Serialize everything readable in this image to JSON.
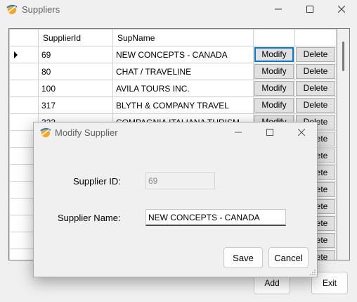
{
  "window": {
    "title": "Suppliers",
    "controls": [
      "minimize",
      "maximize",
      "close"
    ]
  },
  "grid": {
    "columns": [
      "SupplierId",
      "SupName"
    ],
    "button_labels": {
      "modify": "Modify",
      "delete": "Delete"
    },
    "selected_row": 0,
    "rows": [
      {
        "id": "69",
        "name": "NEW CONCEPTS - CANADA"
      },
      {
        "id": "80",
        "name": "CHAT / TRAVELINE"
      },
      {
        "id": "100",
        "name": "AVILA TOURS INC."
      },
      {
        "id": "317",
        "name": "BLYTH & COMPANY TRAVEL"
      },
      {
        "id": "323",
        "name": "COMPAGNIA ITALIANA TURISM"
      },
      {
        "id": "",
        "name": ""
      },
      {
        "id": "",
        "name": ""
      },
      {
        "id": "",
        "name": ""
      },
      {
        "id": "",
        "name": ""
      },
      {
        "id": "",
        "name": ""
      },
      {
        "id": "",
        "name": ""
      },
      {
        "id": "",
        "name": ""
      },
      {
        "id": "",
        "name": ""
      },
      {
        "id": "",
        "name": ""
      }
    ]
  },
  "buttons": {
    "add": "Add",
    "exit": "Exit"
  },
  "dialog": {
    "title": "Modify Supplier",
    "id_label": "Supplier ID:",
    "id_value": "69",
    "name_label": "Supplier Name:",
    "name_value": "NEW CONCEPTS - CANADA",
    "save": "Save",
    "cancel": "Cancel"
  },
  "colors": {
    "focus_border": "#0078d7",
    "app_icon_orange": "#f5a623",
    "app_icon_blue": "#2b78d0"
  }
}
